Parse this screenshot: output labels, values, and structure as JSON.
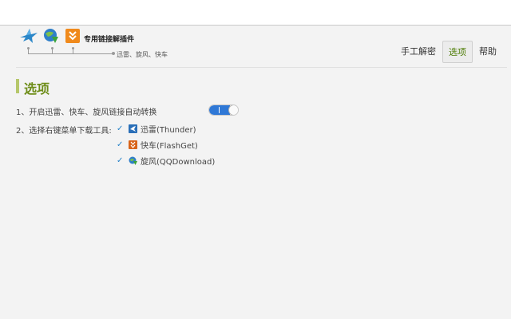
{
  "header": {
    "brand_title": "专用链接解插件",
    "brand_subtitle": "迅雷、旋风、快车",
    "icons": [
      "thunder-bird-icon",
      "qqdownload-globe-icon",
      "flashget-icon"
    ]
  },
  "nav": {
    "items": [
      {
        "label": "手工解密"
      },
      {
        "label": "选项"
      },
      {
        "label": "帮助"
      }
    ],
    "active_index": 1
  },
  "section": {
    "title": "选项",
    "accent_color": "#6e8d19"
  },
  "options": {
    "auto_convert": {
      "label": "1、开启迅雷、快车、旋风链接自动转换",
      "enabled": true,
      "toggle_color": "#2f78d6"
    },
    "tools": {
      "label": "2、选择右键菜单下载工具:",
      "items": [
        {
          "name": "迅雷(Thunder)",
          "checked": true,
          "icon": "thunder-icon"
        },
        {
          "name": "快车(FlashGet)",
          "checked": true,
          "icon": "flashget-icon"
        },
        {
          "name": "旋风(QQDownload)",
          "checked": true,
          "icon": "qqdownload-icon"
        }
      ]
    }
  }
}
